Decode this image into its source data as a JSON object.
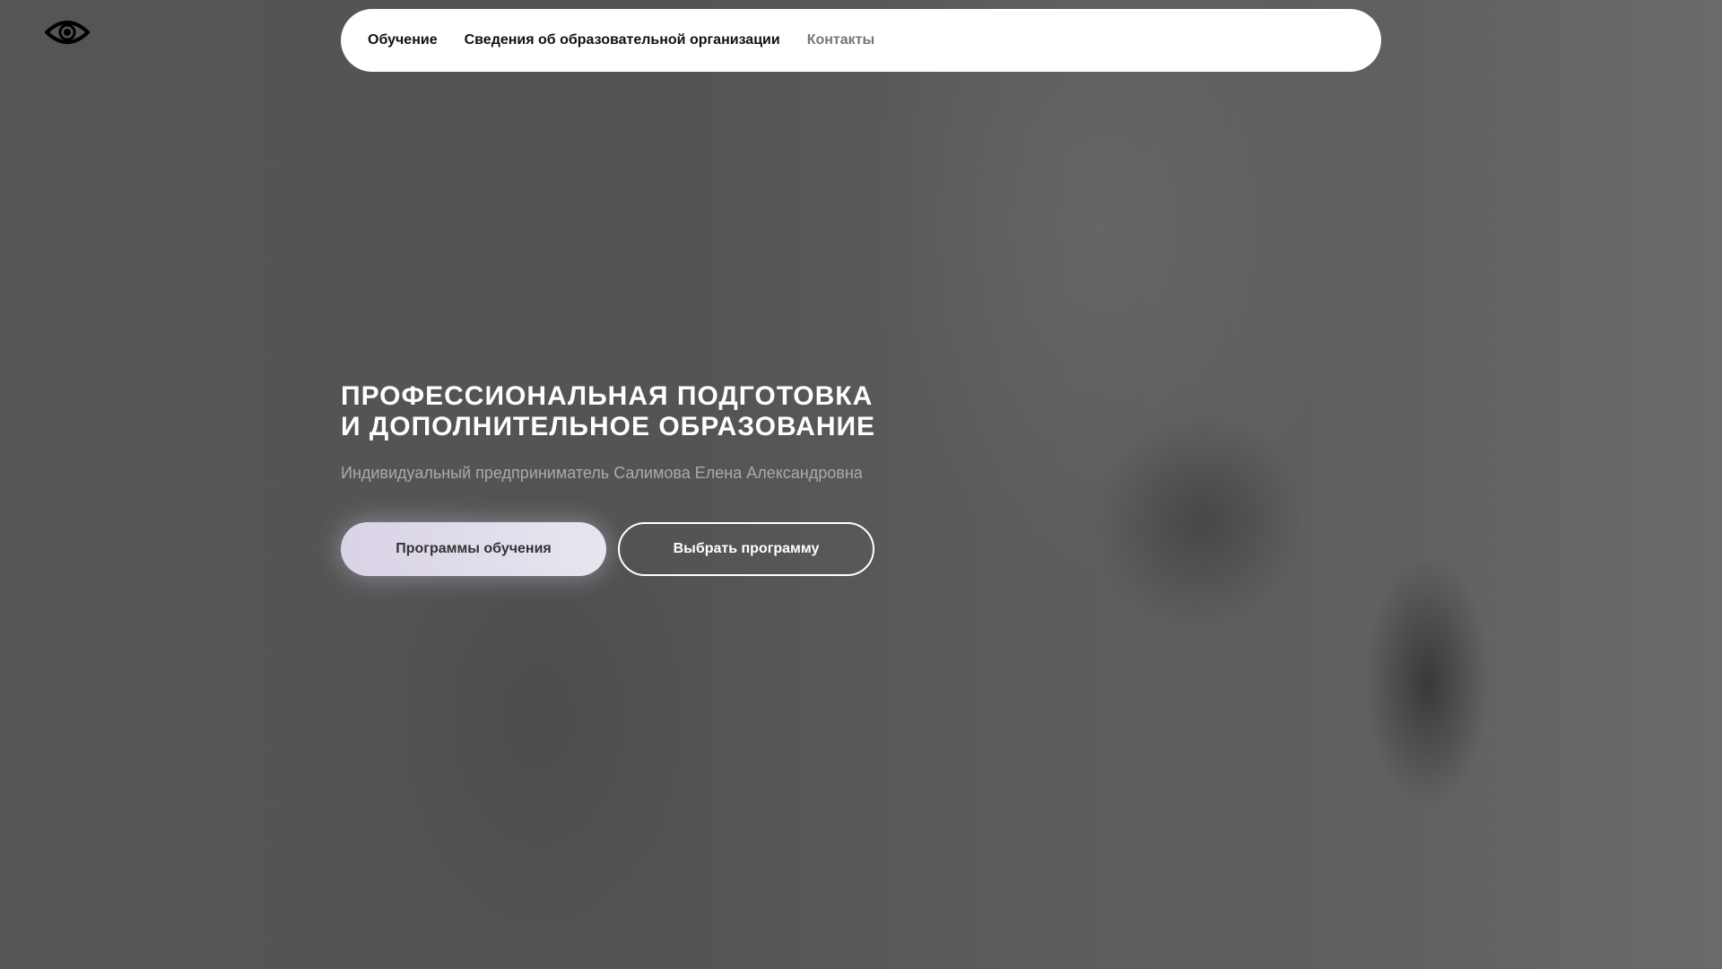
{
  "header": {
    "accessibility_icon": "eye-icon",
    "nav": [
      {
        "label": "Обучение"
      },
      {
        "label": "Сведения об образовательной организации"
      },
      {
        "label": "Контакты"
      }
    ]
  },
  "hero": {
    "title_line1": "ПРОФЕССИОНАЛЬНАЯ ПОДГОТОВКА",
    "title_line2": "И ДОПОЛНИТЕЛЬНОЕ ОБРАЗОВАНИЕ",
    "subtitle": "Индивидуальный предприниматель Салимова Елена Александровна",
    "primary_button": "Программы обучения",
    "secondary_button": "Выбрать программу"
  }
}
